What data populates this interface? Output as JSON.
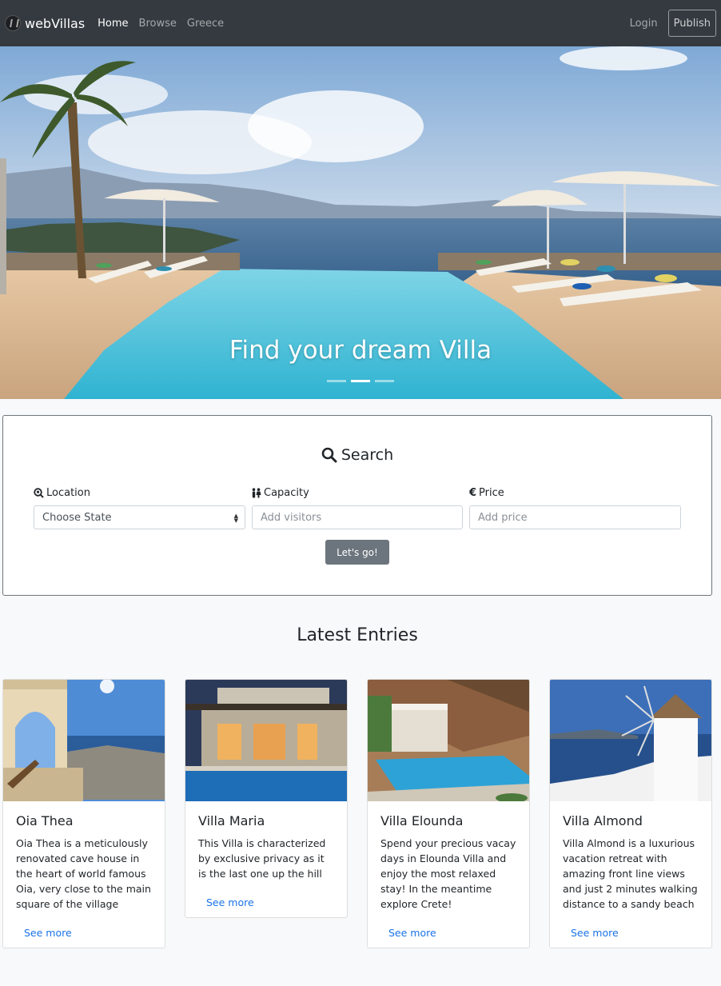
{
  "navbar": {
    "brand": "webVillas",
    "links": [
      "Home",
      "Browse",
      "Greece"
    ],
    "login": "Login",
    "publish": "Publish"
  },
  "hero": {
    "caption": "Find your dream Villa",
    "slides_count": 3,
    "active_slide": 2
  },
  "search": {
    "title": "Search",
    "location_label": "Location",
    "location_value": "Choose State",
    "capacity_label": "Capacity",
    "capacity_placeholder": "Add visitors",
    "price_label": "Price",
    "price_placeholder": "Add price",
    "submit": "Let's go!"
  },
  "latest": {
    "title": "Latest Entries",
    "cards": [
      {
        "title": "Oia Thea",
        "text": "Oia Thea is a meticulously renovated cave house in the heart of world famous Oia, very close to the main square of the village",
        "link": "See more"
      },
      {
        "title": "Villa Maria",
        "text": "This Villa is characterized by exclusive privacy as it is the last one up the hill",
        "link": "See more"
      },
      {
        "title": "Villa Elounda",
        "text": "Spend your precious vacay days in Elounda Villa and enjoy the most relaxed stay! In the meantime explore Crete!",
        "link": "See more"
      },
      {
        "title": "Villa Almond",
        "text": "Villa Almond is a luxurious vacation retreat with amazing front line views and just 2 minutes walking distance to a sandy beach",
        "link": "See more"
      }
    ]
  },
  "colors": {
    "navbar_bg": "#343a40",
    "button_secondary": "#6c757d",
    "link": "#1a73e8"
  }
}
